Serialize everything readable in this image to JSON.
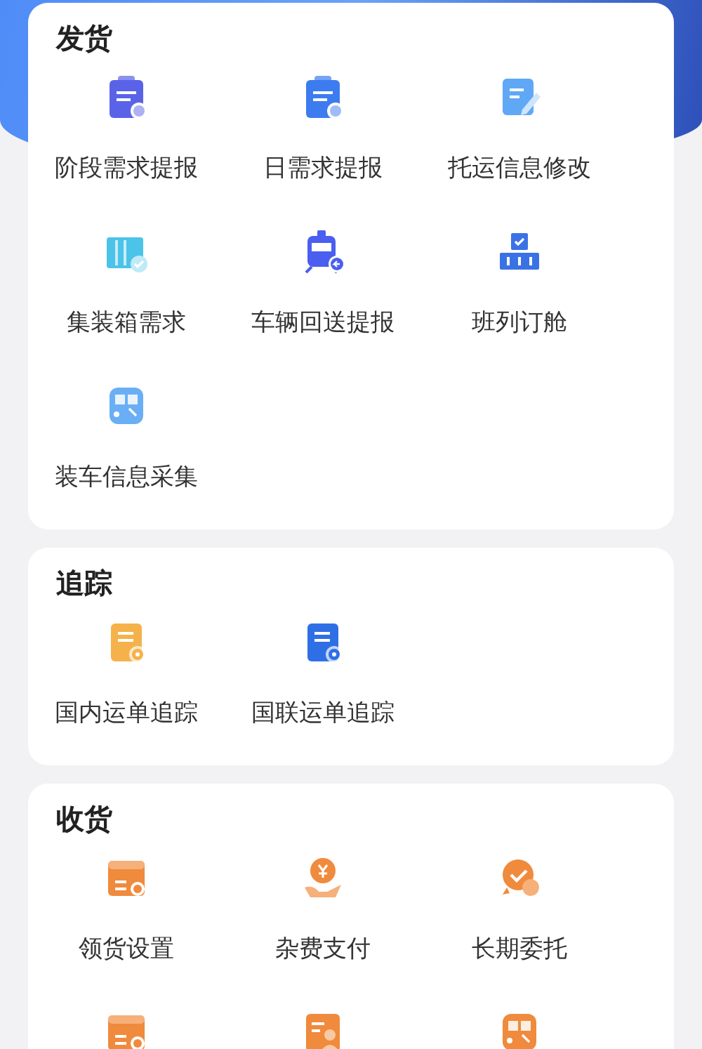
{
  "sections": [
    {
      "title": "发货",
      "items": [
        {
          "kind": "labeled",
          "label": "阶段需求提报"
        },
        {
          "kind": "labeled",
          "label": "日需求提报"
        },
        {
          "kind": "labeled",
          "label": "托运信息修改"
        },
        {
          "kind": "labeled",
          "label": "集装箱需求"
        },
        {
          "kind": "labeled",
          "label": "车辆回送提报"
        },
        {
          "kind": "labeled",
          "label": "班列订舱"
        },
        {
          "kind": "labeled",
          "label": "装车信息采集"
        }
      ]
    },
    {
      "title": "追踪",
      "items": [
        {
          "kind": "labeled",
          "label": "国内运单追踪"
        },
        {
          "kind": "labeled",
          "label": "国联运单追踪"
        }
      ]
    },
    {
      "title": "收货",
      "items": [
        {
          "kind": "labeled",
          "label": "领货设置"
        },
        {
          "kind": "labeled",
          "label": "杂费支付"
        },
        {
          "kind": "labeled",
          "label": "长期委托"
        },
        {
          "kind": "icon-only"
        },
        {
          "kind": "icon-only"
        },
        {
          "kind": "icon-only"
        }
      ]
    }
  ]
}
